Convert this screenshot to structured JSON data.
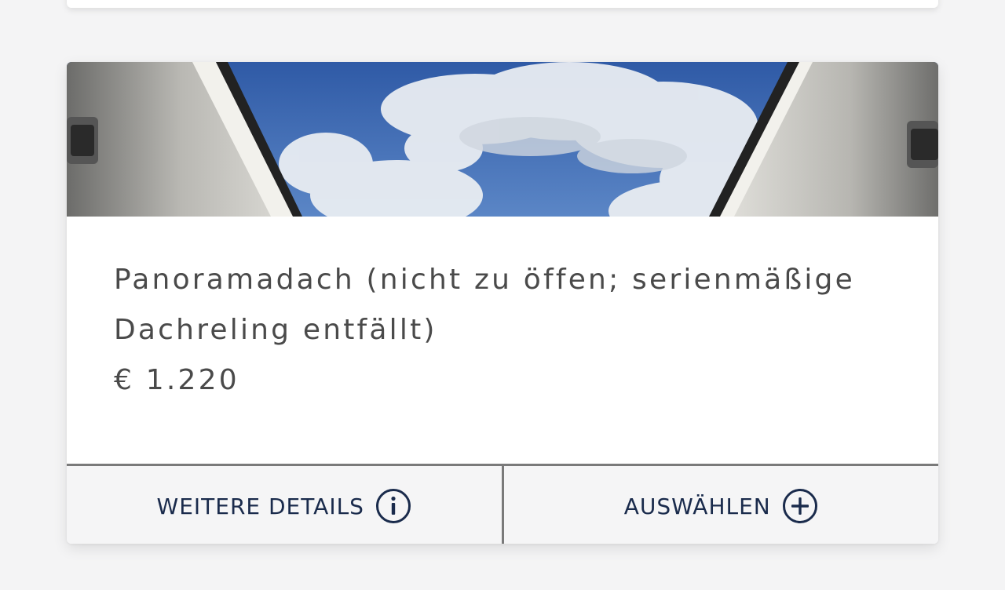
{
  "option": {
    "title": "Panoramadach (nicht zu öffen; serienmäßige Dachreling entfällt)",
    "price": "€ 1.220",
    "image_icon": "panoramic-roof-photo"
  },
  "actions": {
    "details_label": "WEITERE DETAILS",
    "details_icon": "info-circle-icon",
    "select_label": "AUSWÄHLEN",
    "select_icon": "plus-circle-icon"
  },
  "colors": {
    "text": "#4a4a4a",
    "accent": "#1a2b4c",
    "divider": "#7a7a7a",
    "action_bg": "#f5f5f6"
  }
}
